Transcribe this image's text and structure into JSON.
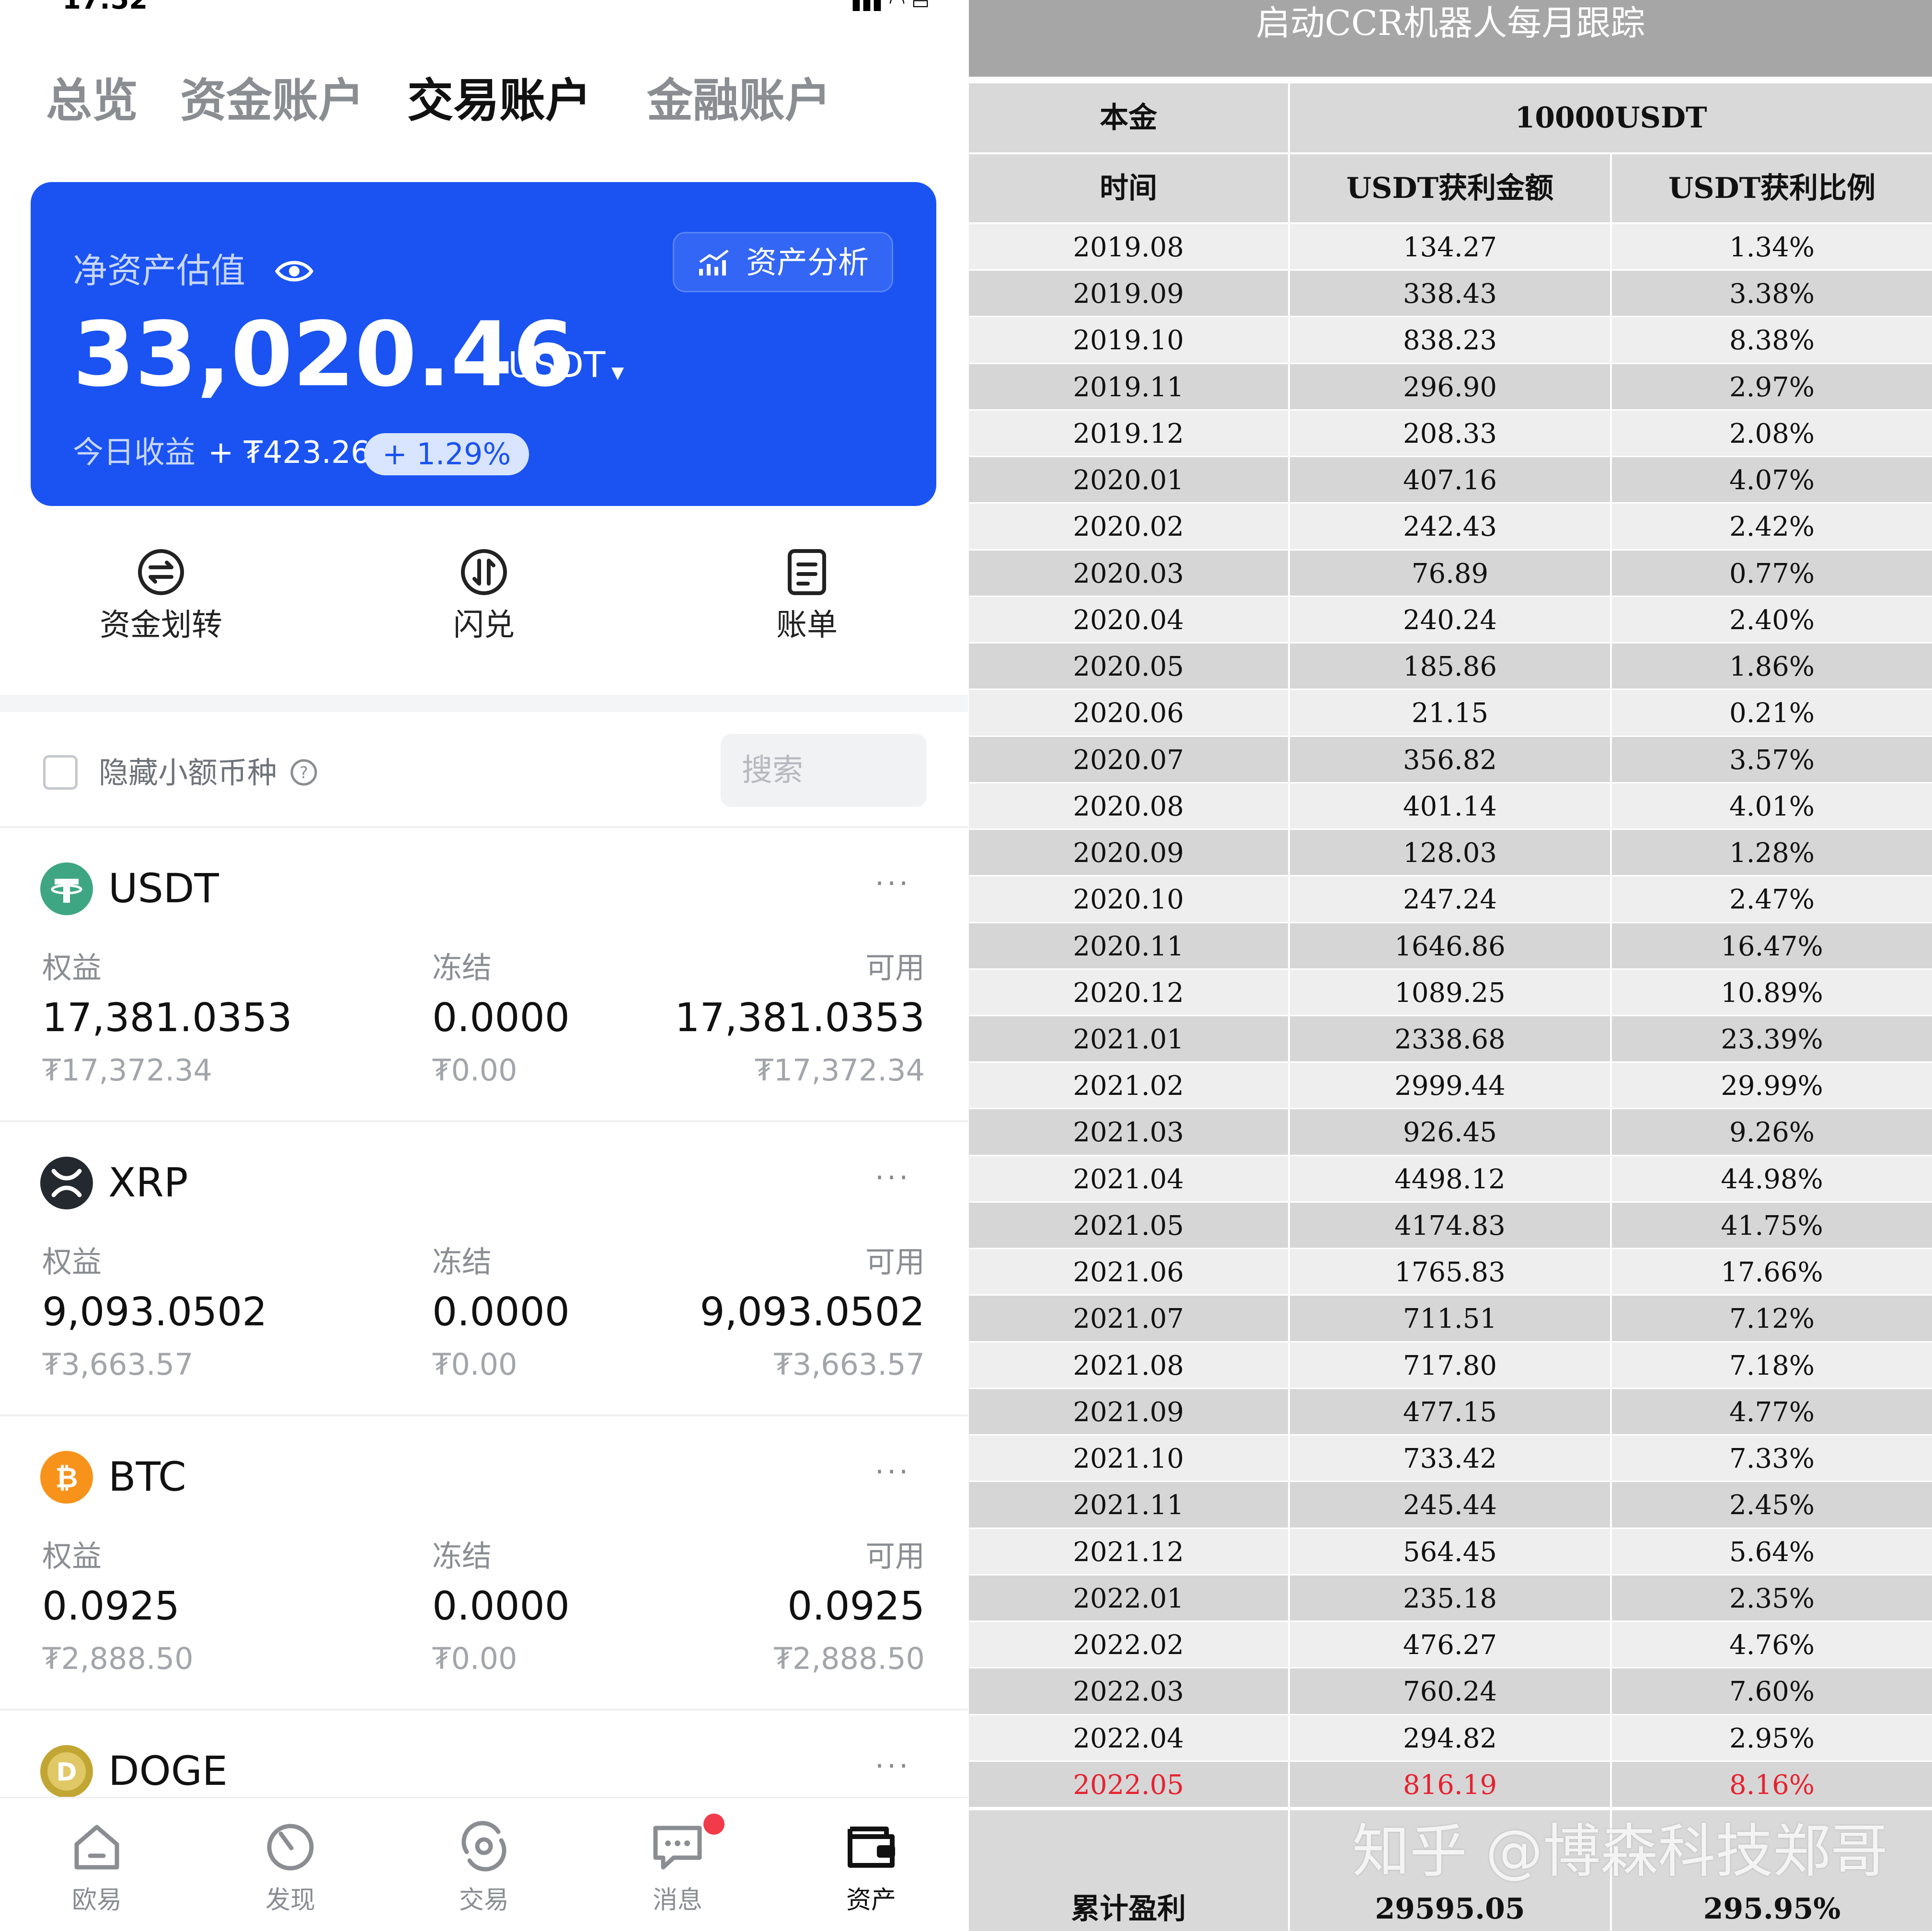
{
  "status_bar": {
    "time": "17:52"
  },
  "tabs": [
    {
      "label": "总览",
      "active": false
    },
    {
      "label": "资金账户",
      "active": false
    },
    {
      "label": "交易账户",
      "active": true
    },
    {
      "label": "金融账户",
      "active": false
    }
  ],
  "summary": {
    "label": "净资产估值",
    "value": "33,020.46",
    "unit": "USDT",
    "analysis_label": "资产分析",
    "today_label": "今日收益",
    "today_value": "+ ₮423.26",
    "today_pct": "+ 1.29%"
  },
  "actions": [
    {
      "label": "资金划转",
      "icon": "transfer-icon"
    },
    {
      "label": "闪兑",
      "icon": "swap-icon"
    },
    {
      "label": "账单",
      "icon": "bill-icon"
    }
  ],
  "filter": {
    "hide_small_label": "隐藏小额币种",
    "search_placeholder": "搜索"
  },
  "asset_columns": {
    "equity": "权益",
    "frozen": "冻结",
    "available": "可用"
  },
  "assets": [
    {
      "name": "USDT",
      "icon": "usdt-icon",
      "color": "#3fa684",
      "equity": "17,381.0353",
      "equity_fiat": "₮17,372.34",
      "frozen": "0.0000",
      "frozen_fiat": "₮0.00",
      "available": "17,381.0353",
      "available_fiat": "₮17,372.34"
    },
    {
      "name": "XRP",
      "icon": "xrp-icon",
      "color": "#23292f",
      "equity": "9,093.0502",
      "equity_fiat": "₮3,663.57",
      "frozen": "0.0000",
      "frozen_fiat": "₮0.00",
      "available": "9,093.0502",
      "available_fiat": "₮3,663.57"
    },
    {
      "name": "BTC",
      "icon": "btc-icon",
      "color": "#f7931a",
      "equity": "0.0925",
      "equity_fiat": "₮2,888.50",
      "frozen": "0.0000",
      "frozen_fiat": "₮0.00",
      "available": "0.0925",
      "available_fiat": "₮2,888.50"
    },
    {
      "name": "DOGE",
      "icon": "doge-icon",
      "color": "#c2a633"
    }
  ],
  "bottom_nav": [
    {
      "label": "欧易",
      "icon": "home-icon",
      "active": false
    },
    {
      "label": "发现",
      "icon": "discover-icon",
      "active": false
    },
    {
      "label": "交易",
      "icon": "trade-icon",
      "active": false
    },
    {
      "label": "消息",
      "icon": "message-icon",
      "active": false,
      "badge": true
    },
    {
      "label": "资产",
      "icon": "wallet-icon",
      "active": true
    }
  ],
  "tracking_table": {
    "title": "启动CCR机器人每月跟踪",
    "principal_label": "本金",
    "principal_value": "10000USDT",
    "headers": [
      "时间",
      "USDT获利金额",
      "USDT获利比例"
    ],
    "rows": [
      [
        "2019.08",
        "134.27",
        "1.34%"
      ],
      [
        "2019.09",
        "338.43",
        "3.38%"
      ],
      [
        "2019.10",
        "838.23",
        "8.38%"
      ],
      [
        "2019.11",
        "296.90",
        "2.97%"
      ],
      [
        "2019.12",
        "208.33",
        "2.08%"
      ],
      [
        "2020.01",
        "407.16",
        "4.07%"
      ],
      [
        "2020.02",
        "242.43",
        "2.42%"
      ],
      [
        "2020.03",
        "76.89",
        "0.77%"
      ],
      [
        "2020.04",
        "240.24",
        "2.40%"
      ],
      [
        "2020.05",
        "185.86",
        "1.86%"
      ],
      [
        "2020.06",
        "21.15",
        "0.21%"
      ],
      [
        "2020.07",
        "356.82",
        "3.57%"
      ],
      [
        "2020.08",
        "401.14",
        "4.01%"
      ],
      [
        "2020.09",
        "128.03",
        "1.28%"
      ],
      [
        "2020.10",
        "247.24",
        "2.47%"
      ],
      [
        "2020.11",
        "1646.86",
        "16.47%"
      ],
      [
        "2020.12",
        "1089.25",
        "10.89%"
      ],
      [
        "2021.01",
        "2338.68",
        "23.39%"
      ],
      [
        "2021.02",
        "2999.44",
        "29.99%"
      ],
      [
        "2021.03",
        "926.45",
        "9.26%"
      ],
      [
        "2021.04",
        "4498.12",
        "44.98%"
      ],
      [
        "2021.05",
        "4174.83",
        "41.75%"
      ],
      [
        "2021.06",
        "1765.83",
        "17.66%"
      ],
      [
        "2021.07",
        "711.51",
        "7.12%"
      ],
      [
        "2021.08",
        "717.80",
        "7.18%"
      ],
      [
        "2021.09",
        "477.15",
        "4.77%"
      ],
      [
        "2021.10",
        "733.42",
        "7.33%"
      ],
      [
        "2021.11",
        "245.44",
        "2.45%"
      ],
      [
        "2021.12",
        "564.45",
        "5.64%"
      ],
      [
        "2022.01",
        "235.18",
        "2.35%"
      ],
      [
        "2022.02",
        "476.27",
        "4.76%"
      ],
      [
        "2022.03",
        "760.24",
        "7.60%"
      ],
      [
        "2022.04",
        "294.82",
        "2.95%"
      ],
      [
        "2022.05",
        "816.19",
        "8.16%"
      ]
    ],
    "highlight_row_color": "#e8212f",
    "total_label": "累计盈利",
    "total_amount": "29595.05",
    "total_pct": "295.95%",
    "watermark": "知乎 @博森科技郑哥"
  }
}
